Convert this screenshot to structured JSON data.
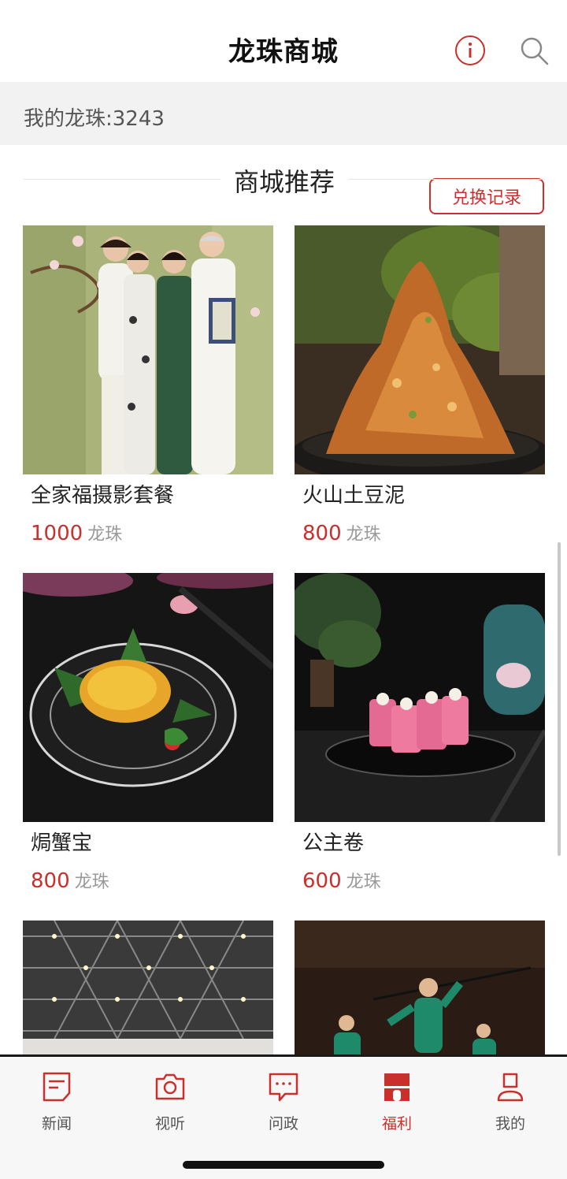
{
  "header": {
    "title": "龙珠商城",
    "info_icon": "info-icon",
    "search_icon": "search-icon"
  },
  "points_bar": {
    "points_text": "我的龙珠:3243",
    "history_button": "兑换记录"
  },
  "section": {
    "title": "商城推荐"
  },
  "products": [
    {
      "name": "全家福摄影套餐",
      "price": "1000",
      "unit": "龙珠"
    },
    {
      "name": "火山土豆泥",
      "price": "800",
      "unit": "龙珠"
    },
    {
      "name": "焗蟹宝",
      "price": "800",
      "unit": "龙珠"
    },
    {
      "name": "公主卷",
      "price": "600",
      "unit": "龙珠"
    },
    {
      "name": "",
      "price": "",
      "unit": ""
    },
    {
      "name": "",
      "price": "",
      "unit": ""
    }
  ],
  "tabbar": {
    "items": [
      {
        "label": "新闻",
        "icon": "news-icon",
        "active": false
      },
      {
        "label": "视听",
        "icon": "camera-icon",
        "active": false
      },
      {
        "label": "问政",
        "icon": "chat-icon",
        "active": false
      },
      {
        "label": "福利",
        "icon": "gift-icon",
        "active": true
      },
      {
        "label": "我的",
        "icon": "profile-icon",
        "active": false
      }
    ]
  },
  "colors": {
    "accent": "#c9302c",
    "price": "#c9302c",
    "muted": "#999999",
    "bar_bg": "#f2f2f2"
  }
}
